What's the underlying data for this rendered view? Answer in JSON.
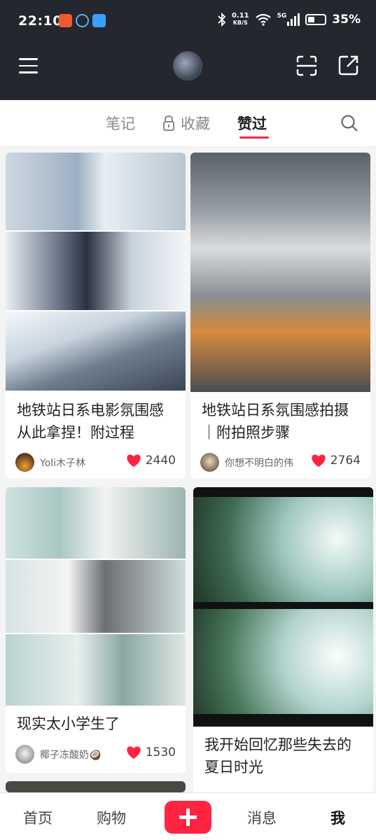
{
  "status_bar": {
    "time": "22:10",
    "network_speed_value": "0.11",
    "network_speed_unit": "KB/S",
    "network_type": "5G",
    "battery": "35%",
    "icons": [
      "bluetooth-icon",
      "wifi-icon",
      "signal-icon",
      "battery-icon"
    ]
  },
  "header": {
    "icons": [
      "menu-icon",
      "avatar",
      "scan-icon",
      "share-icon"
    ]
  },
  "tabs": [
    {
      "label": "笔记",
      "active": false
    },
    {
      "label": "收藏",
      "active": false,
      "icon": "lock-icon"
    },
    {
      "label": "赞过",
      "active": true
    }
  ],
  "accent_color": "#ff2442",
  "feed": [
    {
      "title_line1": "地铁站日系电影氛围感",
      "title_line2": "从此拿捏！附过程",
      "author": "Yoli木子林",
      "likes": "2440"
    },
    {
      "title_line1": "地铁站日系氛围感拍摄",
      "title_line2": "｜附拍照步骤",
      "author": "你想不明白的伟",
      "likes": "2764"
    },
    {
      "title_line1": "现实太小学生了",
      "title_line2": "",
      "author": "椰子冻酸奶🥥",
      "likes": "1530"
    },
    {
      "title_line1": "我开始回忆那些失去的",
      "title_line2": "夏日时光",
      "author": "",
      "likes": ""
    }
  ],
  "bottom_nav": {
    "home": "首页",
    "shop": "购物",
    "add": "+",
    "messages": "消息",
    "me": "我"
  }
}
